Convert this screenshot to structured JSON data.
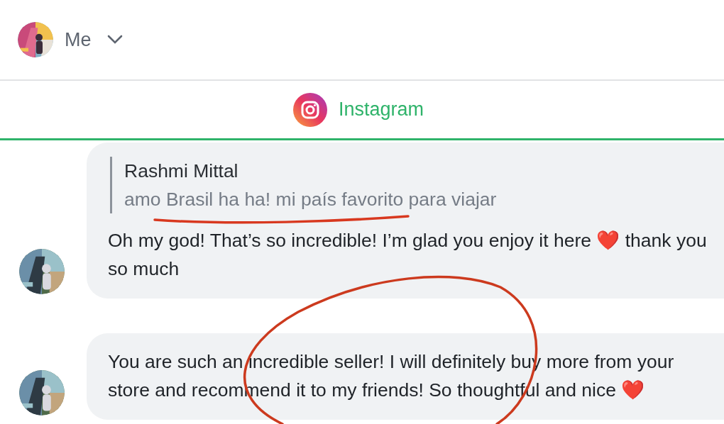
{
  "user": {
    "name": "Me"
  },
  "channel_tab": {
    "label": "Instagram",
    "selected": true
  },
  "messages": [
    {
      "reply_to": {
        "author": "Rashmi Mittal",
        "text": "amo Brasil ha ha! mi país favorito para viajar"
      },
      "text": "Oh my god! That’s so incredible! I’m glad you enjoy it here ❤️ thank you so much"
    },
    {
      "text": "You are such an incredible seller! I will definitely buy more from your store and recommend it to my friends! So thoughtful and nice ❤️"
    }
  ]
}
